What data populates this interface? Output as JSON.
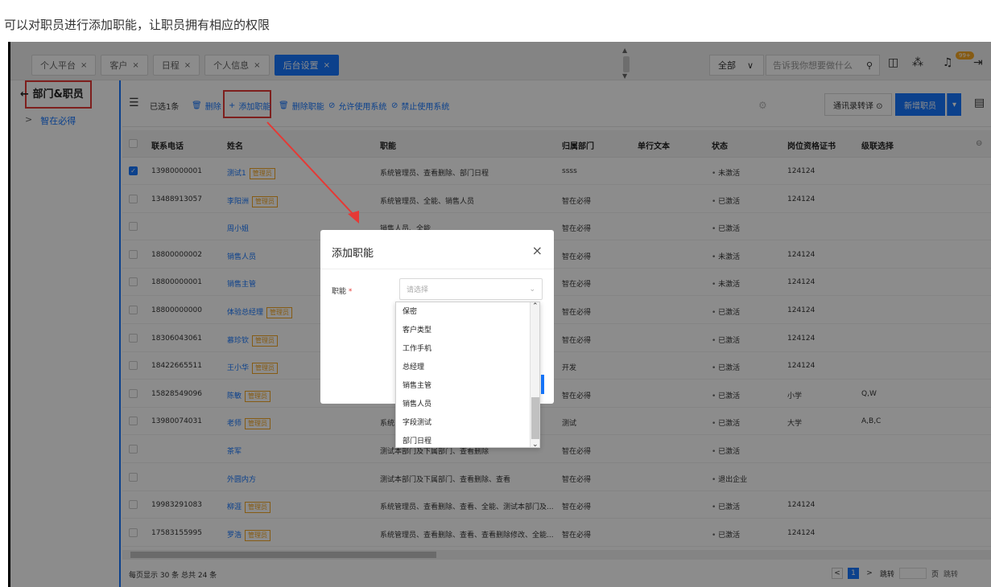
{
  "caption": "可以对职员进行添加职能，让职员拥有相应的权限",
  "tabs": [
    {
      "label": "个人平台",
      "close": "×",
      "active": false
    },
    {
      "label": "客户",
      "close": "×",
      "active": false
    },
    {
      "label": "日程",
      "close": "×",
      "active": false
    },
    {
      "label": "个人信息",
      "close": "×",
      "active": false
    },
    {
      "label": "后台设置",
      "close": "×",
      "active": true
    }
  ],
  "topbar": {
    "scope": "全部",
    "scope_chevron": "∨",
    "search_placeholder": "告诉我你想要做什么",
    "notification_badge": "99+",
    "icons": [
      "search-icon",
      "panel-icon",
      "apps-icon",
      "bell-icon",
      "logout-icon"
    ]
  },
  "leftnav": {
    "title": "部门&职员",
    "back_arrow": "←",
    "item": "智在必得",
    "item_chevron": ">"
  },
  "toolbar": {
    "selected": "已选1条",
    "delete": "删除",
    "add_function": "添加职能",
    "delete_function": "删除职能",
    "allow_system": "允许使用系统",
    "forbid_system": "禁止使用系统",
    "contacts_transfer": "通讯录转译 ⊙",
    "new_staff": "新增职员",
    "new_staff_dropdown": "▾",
    "add_prefix": "+",
    "allow_prefix": "⊘",
    "forbid_prefix": "⊘",
    "delete_prefix": "🗑"
  },
  "table": {
    "columns": [
      "联系电话",
      "姓名",
      "职能",
      "归属部门",
      "单行文本",
      "状态",
      "岗位资格证书",
      "级联选择"
    ],
    "rows": [
      {
        "phone": "13980000001",
        "name": "测试1",
        "tag": "管理员",
        "func": "系统管理员、查看删除、部门日程",
        "dept": "ssss",
        "text": "",
        "status": "未激活",
        "cert": "124124",
        "cascade": "",
        "checked": true
      },
      {
        "phone": "13488913057",
        "name": "李阳洲",
        "tag": "管理员",
        "func": "系统管理员、全能、销售人员",
        "dept": "智在必得",
        "text": "",
        "status": "已激活",
        "cert": "124124",
        "cascade": "",
        "checked": false
      },
      {
        "phone": "",
        "name": "周小姐",
        "tag": "",
        "func": "销售人员、全能",
        "dept": "智在必得",
        "text": "",
        "status": "已激活",
        "cert": "",
        "cascade": "",
        "checked": false
      },
      {
        "phone": "18800000002",
        "name": "销售人员",
        "tag": "",
        "func": "",
        "dept": "智在必得",
        "text": "",
        "status": "未激活",
        "cert": "124124",
        "cascade": "",
        "checked": false
      },
      {
        "phone": "18800000001",
        "name": "销售主管",
        "tag": "",
        "func": "",
        "dept": "智在必得",
        "text": "",
        "status": "未激活",
        "cert": "124124",
        "cascade": "",
        "checked": false
      },
      {
        "phone": "18800000000",
        "name": "体验总经理",
        "tag": "管理员",
        "func": "",
        "dept": "智在必得",
        "text": "",
        "status": "已激活",
        "cert": "124124",
        "cascade": "",
        "checked": false
      },
      {
        "phone": "18306043061",
        "name": "慕珍钦",
        "tag": "管理员",
        "func": "",
        "dept": "智在必得",
        "text": "",
        "status": "已激活",
        "cert": "124124",
        "cascade": "",
        "checked": false
      },
      {
        "phone": "18422665511",
        "name": "王小华",
        "tag": "管理员",
        "func": "",
        "dept": "开发",
        "text": "",
        "status": "已激活",
        "cert": "124124",
        "cascade": "",
        "checked": false
      },
      {
        "phone": "15828549096",
        "name": "陈敏",
        "tag": "管理员",
        "func": "",
        "dept": "智在必得",
        "text": "",
        "status": "已激活",
        "cert": "小学",
        "cascade": "Q,W",
        "checked": false
      },
      {
        "phone": "13980074031",
        "name": "老师",
        "tag": "管理员",
        "func": "系统",
        "dept": "测试",
        "text": "",
        "status": "已激活",
        "cert": "大学",
        "cascade": "A,B,C",
        "checked": false
      },
      {
        "phone": "",
        "name": "茶军",
        "tag": "",
        "func": "测试本部门及下属部门、查看删除",
        "dept": "智在必得",
        "text": "",
        "status": "已激活",
        "cert": "",
        "cascade": "",
        "checked": false
      },
      {
        "phone": "",
        "name": "外圆内方",
        "tag": "",
        "func": "测试本部门及下属部门、查看删除、查看",
        "dept": "智在必得",
        "text": "",
        "status": "退出企业",
        "cert": "",
        "cascade": "",
        "checked": false
      },
      {
        "phone": "19983291083",
        "name": "柳涯",
        "tag": "管理员",
        "func": "系统管理员、查看删除、查看、全能、测试本部门及...",
        "dept": "智在必得",
        "text": "",
        "status": "已激活",
        "cert": "124124",
        "cascade": "",
        "checked": false
      },
      {
        "phone": "17583155995",
        "name": "罗浩",
        "tag": "管理员",
        "func": "系统管理员、查看删除、查看、查看删除修改、全能...",
        "dept": "智在必得",
        "text": "",
        "status": "已激活",
        "cert": "124124",
        "cascade": "",
        "checked": false
      }
    ]
  },
  "footer": {
    "summary": "每页显示 30 条 总共 24 条",
    "current_page": "1",
    "jump": "跳转",
    "page_unit": "页",
    "jump_btn": "跳转",
    "prev": "<",
    "next": ">"
  },
  "modal": {
    "title": "添加职能",
    "close": "×",
    "field_label": "职能",
    "required": "*",
    "placeholder": "请选择",
    "options": [
      "保密",
      "客户类型",
      "工作手机",
      "总经理",
      "销售主管",
      "销售人员",
      "字段测试",
      "部门日程"
    ]
  },
  "colors": {
    "accent": "#1677ff",
    "highlight": "#e53935",
    "tag": "#f5a623"
  }
}
